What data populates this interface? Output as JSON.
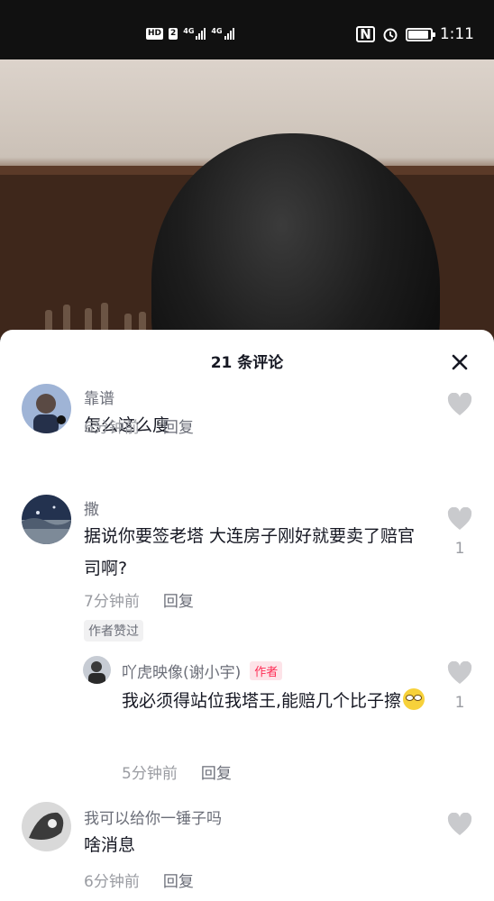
{
  "status_bar": {
    "hd_label": "HD",
    "hd_num": "2",
    "net1": "4G",
    "net2": "4G",
    "nfc": "N",
    "time": "1:11",
    "battery_level": 0.9
  },
  "sheet": {
    "title": "21 条评论",
    "close_icon": "close-icon"
  },
  "comments": [
    {
      "user": "靠谱",
      "text": "怎么这么廋",
      "time": "6分钟前",
      "reply": "回复",
      "likes": ""
    },
    {
      "user": "撒",
      "text": "据说你要签老塔 大连房子刚好就要卖了赔官司啊?",
      "time": "7分钟前",
      "reply": "回复",
      "likes": "1",
      "author_liked": "作者赞过"
    },
    {
      "user": "吖虎映像(谢小宇)",
      "author_tag": "作者",
      "text": "我必须得站位我塔王,能赔几个比子擦",
      "emoji": "grinning-emoji",
      "time": "5分钟前",
      "reply": "回复",
      "likes": "1"
    },
    {
      "user": "我可以给你一锤子吗",
      "text": "啥消息",
      "time": "6分钟前",
      "reply": "回复",
      "likes": ""
    }
  ],
  "colors": {
    "accent": "#fe2c55",
    "text_primary": "#161823",
    "text_secondary": "#9a9ca2"
  }
}
